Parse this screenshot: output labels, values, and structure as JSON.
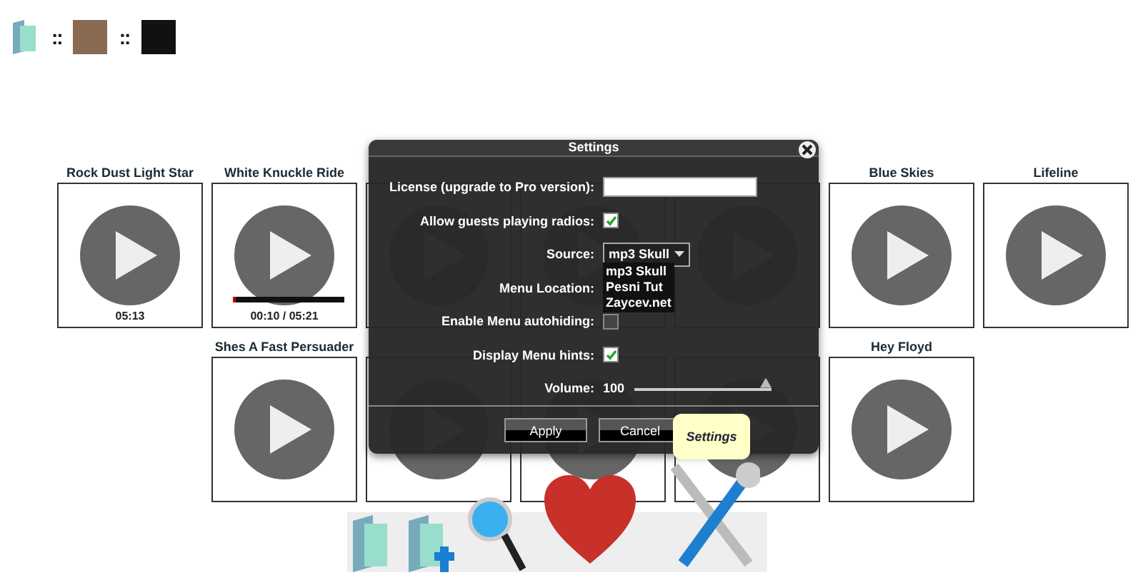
{
  "top_bar": {
    "separators": [
      "::",
      "::"
    ]
  },
  "tiles_row_1": [
    {
      "kind": "track",
      "title": "Rock Dust Light Star",
      "time": "05:13"
    },
    {
      "kind": "track",
      "title": "White Knuckle Ride",
      "time": "00:10 / 05:21",
      "level": 0.03
    },
    {
      "kind": "covered"
    },
    {
      "kind": "covered"
    },
    {
      "kind": "covered"
    },
    {
      "kind": "track",
      "title": "Blue Skies"
    },
    {
      "kind": "track",
      "title": "Lifeline"
    }
  ],
  "tiles_row_2": [
    {
      "kind": "track",
      "title": "Shes A Fast Persuader"
    },
    {
      "kind": "covered"
    },
    {
      "kind": "covered"
    },
    {
      "kind": "covered"
    },
    {
      "kind": "track",
      "title": "Hey Floyd"
    }
  ],
  "settings_dialog": {
    "title": "Settings",
    "license": {
      "label": "License (upgrade to Pro version):"
    },
    "allow_guests": {
      "label": "Allow guests playing radios:",
      "checked": true
    },
    "source": {
      "label": "Source:",
      "value": "mp3 Skull",
      "options": [
        "mp3 Skull",
        "Pesni Tut",
        "Zaycev.net"
      ]
    },
    "menu_location": {
      "label": "Menu Location:"
    },
    "autohiding": {
      "label": "Enable Menu autohiding:",
      "checked": false
    },
    "menu_hints": {
      "label": "Display Menu hints:",
      "checked": true
    },
    "volume": {
      "label": "Volume:",
      "reading": "100",
      "level": 1
    },
    "buttons": [
      "Apply",
      "Cancel"
    ]
  },
  "tooltip": "Settings"
}
